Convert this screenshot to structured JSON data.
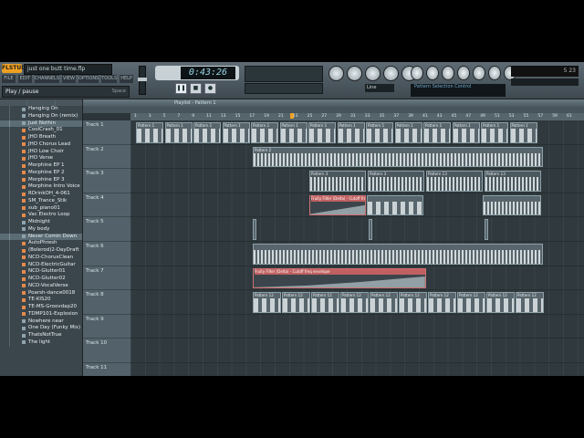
{
  "app": {
    "logo": "FLSTUDIO",
    "filename": "just one butt time.flp",
    "hint": "Play / pause",
    "hint_key": "Space",
    "clock": "0:43:26",
    "tempo": "",
    "snap": "Line",
    "meter_values": "5  23",
    "hint_panel": "Pattern  Selection Control"
  },
  "menu": [
    "FILE",
    "EDIT",
    "CHANNELS",
    "VIEW",
    "OPTIONS",
    "TOOLS",
    "HELP"
  ],
  "playlist": {
    "title": "Playlist - Pattern 1",
    "ruler": [
      "1",
      "3",
      "5",
      "7",
      "9",
      "11",
      "13",
      "15",
      "17",
      "19",
      "21",
      "23",
      "25",
      "27",
      "29",
      "31",
      "33",
      "35",
      "37",
      "39",
      "41",
      "43",
      "45",
      "47",
      "49",
      "51",
      "53",
      "55",
      "57",
      "59",
      "61"
    ],
    "tracks": [
      "Track 1",
      "Track 2",
      "Track 3",
      "Track 4",
      "Track 5",
      "Track 6",
      "Track 7",
      "Track 8",
      "Track 9",
      "Track 10",
      "Track 11"
    ],
    "clip_labels": {
      "pattern1": "Pattern 1",
      "pattern2": "Pattern 2",
      "pattern3": "Pattern 3",
      "pattern12": "Pattern 12",
      "pattern13": "Pattern 13",
      "auto1": "Fruity Filter (Delta) - Cutoff freq",
      "auto2": "Fruity Filter (Delta) - Cutoff freq envelope"
    }
  },
  "browser": {
    "items": [
      {
        "label": "Hanging On",
        "type": "folder"
      },
      {
        "label": "Hanging On (remix)",
        "type": "folder"
      },
      {
        "label": "Just Nothin",
        "type": "folder",
        "selected": true
      },
      {
        "label": "CoolCrash_01",
        "type": "file"
      },
      {
        "label": "JHO Breath",
        "type": "file"
      },
      {
        "label": "JHO Chorus Lead",
        "type": "file"
      },
      {
        "label": "JHO Low Choir",
        "type": "file"
      },
      {
        "label": "JHO Verse",
        "type": "file"
      },
      {
        "label": "Morphine EP 1",
        "type": "file"
      },
      {
        "label": "Morphine EP 2",
        "type": "file"
      },
      {
        "label": "Morphine EP 3",
        "type": "file"
      },
      {
        "label": "Morphine Intro Voice",
        "type": "file"
      },
      {
        "label": "RDrinkOH_4-061",
        "type": "file"
      },
      {
        "label": "SM_Trance_Stik",
        "type": "file"
      },
      {
        "label": "sub_piano01",
        "type": "file"
      },
      {
        "label": "Vac Electro Loop",
        "type": "file"
      },
      {
        "label": "Midnight",
        "type": "folder"
      },
      {
        "label": "My body",
        "type": "folder"
      },
      {
        "label": "Never Comin Down",
        "type": "folder",
        "selected": true
      },
      {
        "label": "AutoPhresh",
        "type": "file"
      },
      {
        "label": "(Bolerod)2-DayDraft",
        "type": "file"
      },
      {
        "label": "NCD-ChorusClean",
        "type": "file"
      },
      {
        "label": "NCD-ElectricGuitar",
        "type": "file"
      },
      {
        "label": "NCD-Glutter01",
        "type": "file"
      },
      {
        "label": "NCD-Glutter02",
        "type": "file"
      },
      {
        "label": "NCD-VocalVerse",
        "type": "file"
      },
      {
        "label": "Poarsh-dance0018",
        "type": "file"
      },
      {
        "label": "TE-KIS20",
        "type": "file"
      },
      {
        "label": "TE-MS-Groovdap20",
        "type": "file"
      },
      {
        "label": "TDMP101-Explosion",
        "type": "file"
      },
      {
        "label": "Nowhere near",
        "type": "folder"
      },
      {
        "label": "One Day (Funky Mix)",
        "type": "folder"
      },
      {
        "label": "ThatsNotTrue",
        "type": "folder"
      },
      {
        "label": "The light",
        "type": "folder"
      }
    ]
  }
}
